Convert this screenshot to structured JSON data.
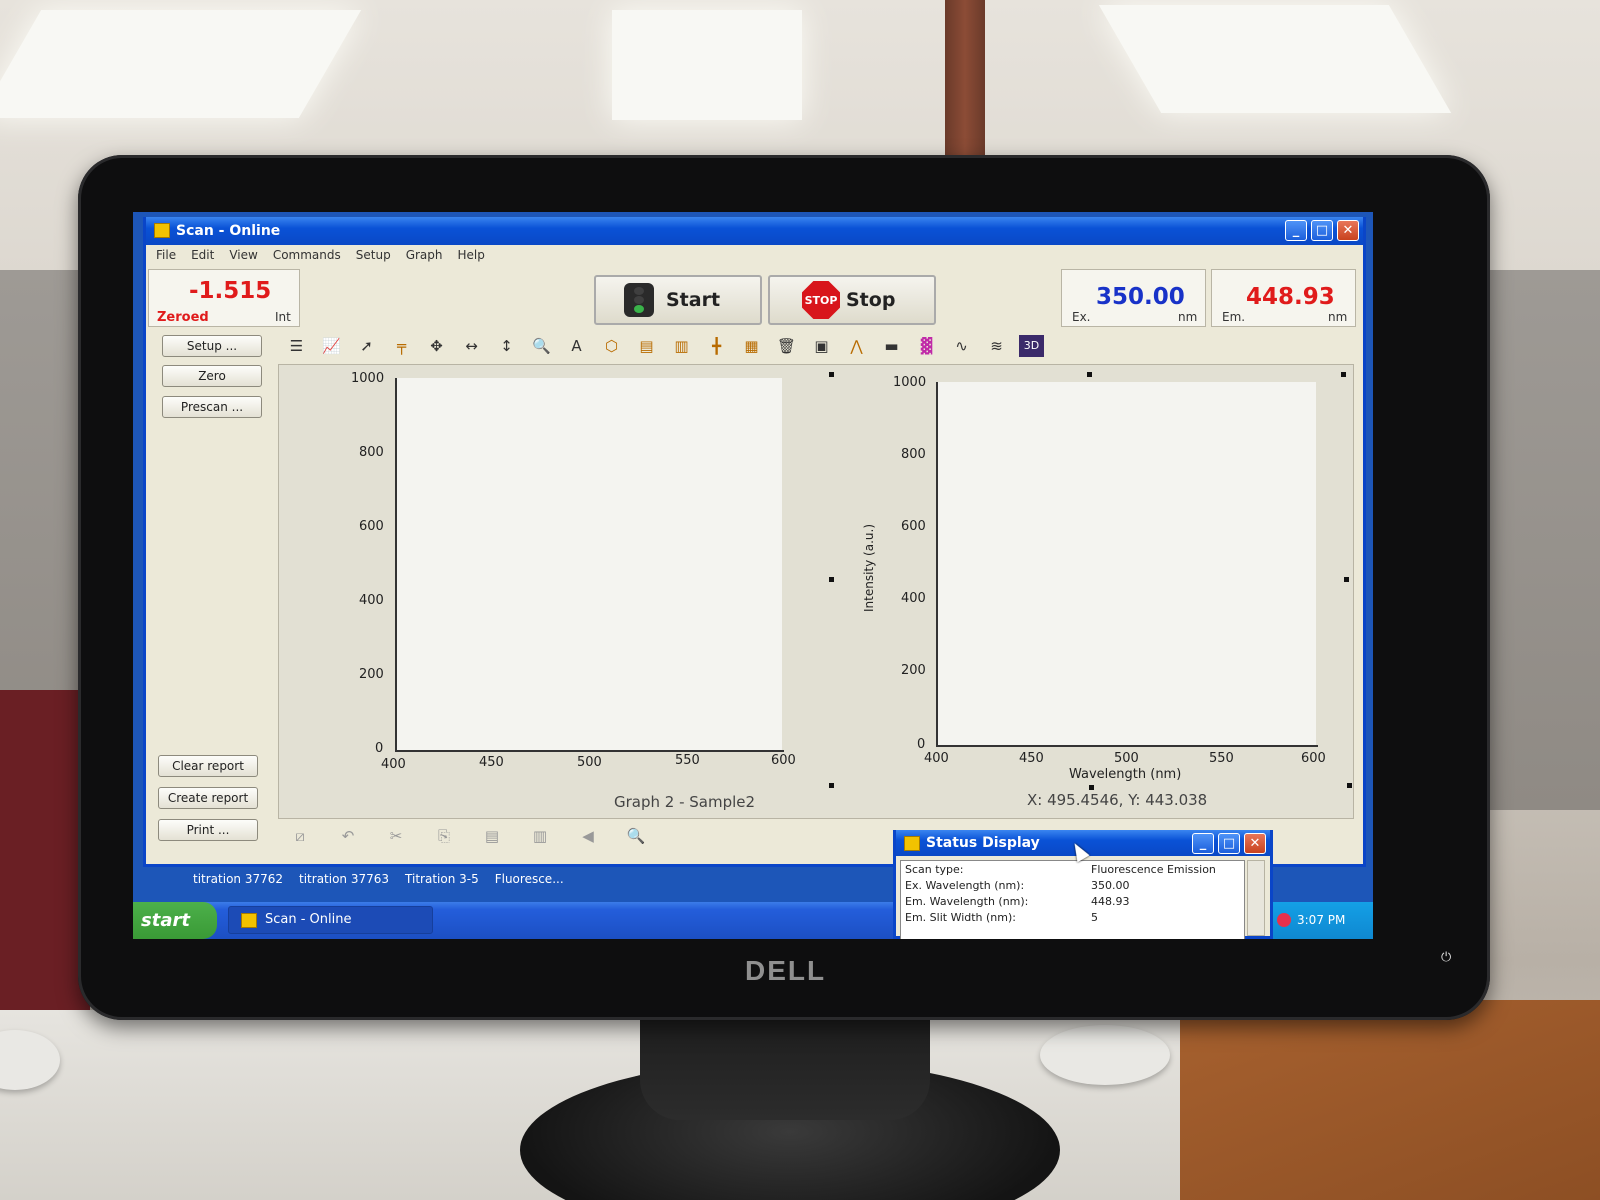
{
  "window": {
    "title": "Scan - Online"
  },
  "menu": [
    "File",
    "Edit",
    "View",
    "Commands",
    "Setup",
    "Graph",
    "Help"
  ],
  "readout": {
    "value": "-1.515",
    "status": "Zeroed",
    "unit": "Int"
  },
  "controls": {
    "start_label": "Start",
    "stop_label": "Stop",
    "stop_sign_text": "STOP"
  },
  "excitation": {
    "label": "Ex.",
    "value": "350.00",
    "unit": "nm"
  },
  "emission": {
    "label": "Em.",
    "value": "448.93",
    "unit": "nm"
  },
  "side_buttons": {
    "setup": "Setup ...",
    "zero": "Zero",
    "prescan": "Prescan ...",
    "clear_report": "Clear report",
    "create_report": "Create report",
    "print": "Print ..."
  },
  "graph1": {
    "caption": "Graph 2 - Sample2",
    "x_ticks": [
      "400",
      "450",
      "500",
      "550",
      "600"
    ],
    "y_ticks": [
      "1000",
      "800",
      "600",
      "400",
      "200",
      "0"
    ]
  },
  "graph2": {
    "y_axis_label": "Intensity (a.u.)",
    "x_axis_label": "Wavelength (nm)",
    "x_ticks": [
      "400",
      "450",
      "500",
      "550",
      "600"
    ],
    "y_ticks": [
      "1000",
      "800",
      "600",
      "400",
      "200",
      "0"
    ],
    "cursor_readout": "X: 495.4546, Y: 443.038"
  },
  "desktop_labels": [
    "titration 37762",
    "titration 37763",
    "Titration 3-5",
    "Fluoresce..."
  ],
  "taskbar": {
    "start": "start",
    "task": "Scan - Online",
    "clock": "3:07 PM"
  },
  "status_display": {
    "title": "Status Display",
    "rows": [
      {
        "key": "Scan type:",
        "value": "Fluorescence Emission"
      },
      {
        "key": "Ex. Wavelength (nm):",
        "value": "350.00"
      },
      {
        "key": "Em. Wavelength (nm):",
        "value": "448.93"
      },
      {
        "key": "Em. Slit Width (nm):",
        "value": "5"
      }
    ]
  },
  "brand": "DELL",
  "colors": {
    "readout_red": "#e01b1b",
    "excitation_blue": "#1832c8",
    "titlebar_blue": "#0a52d6"
  }
}
